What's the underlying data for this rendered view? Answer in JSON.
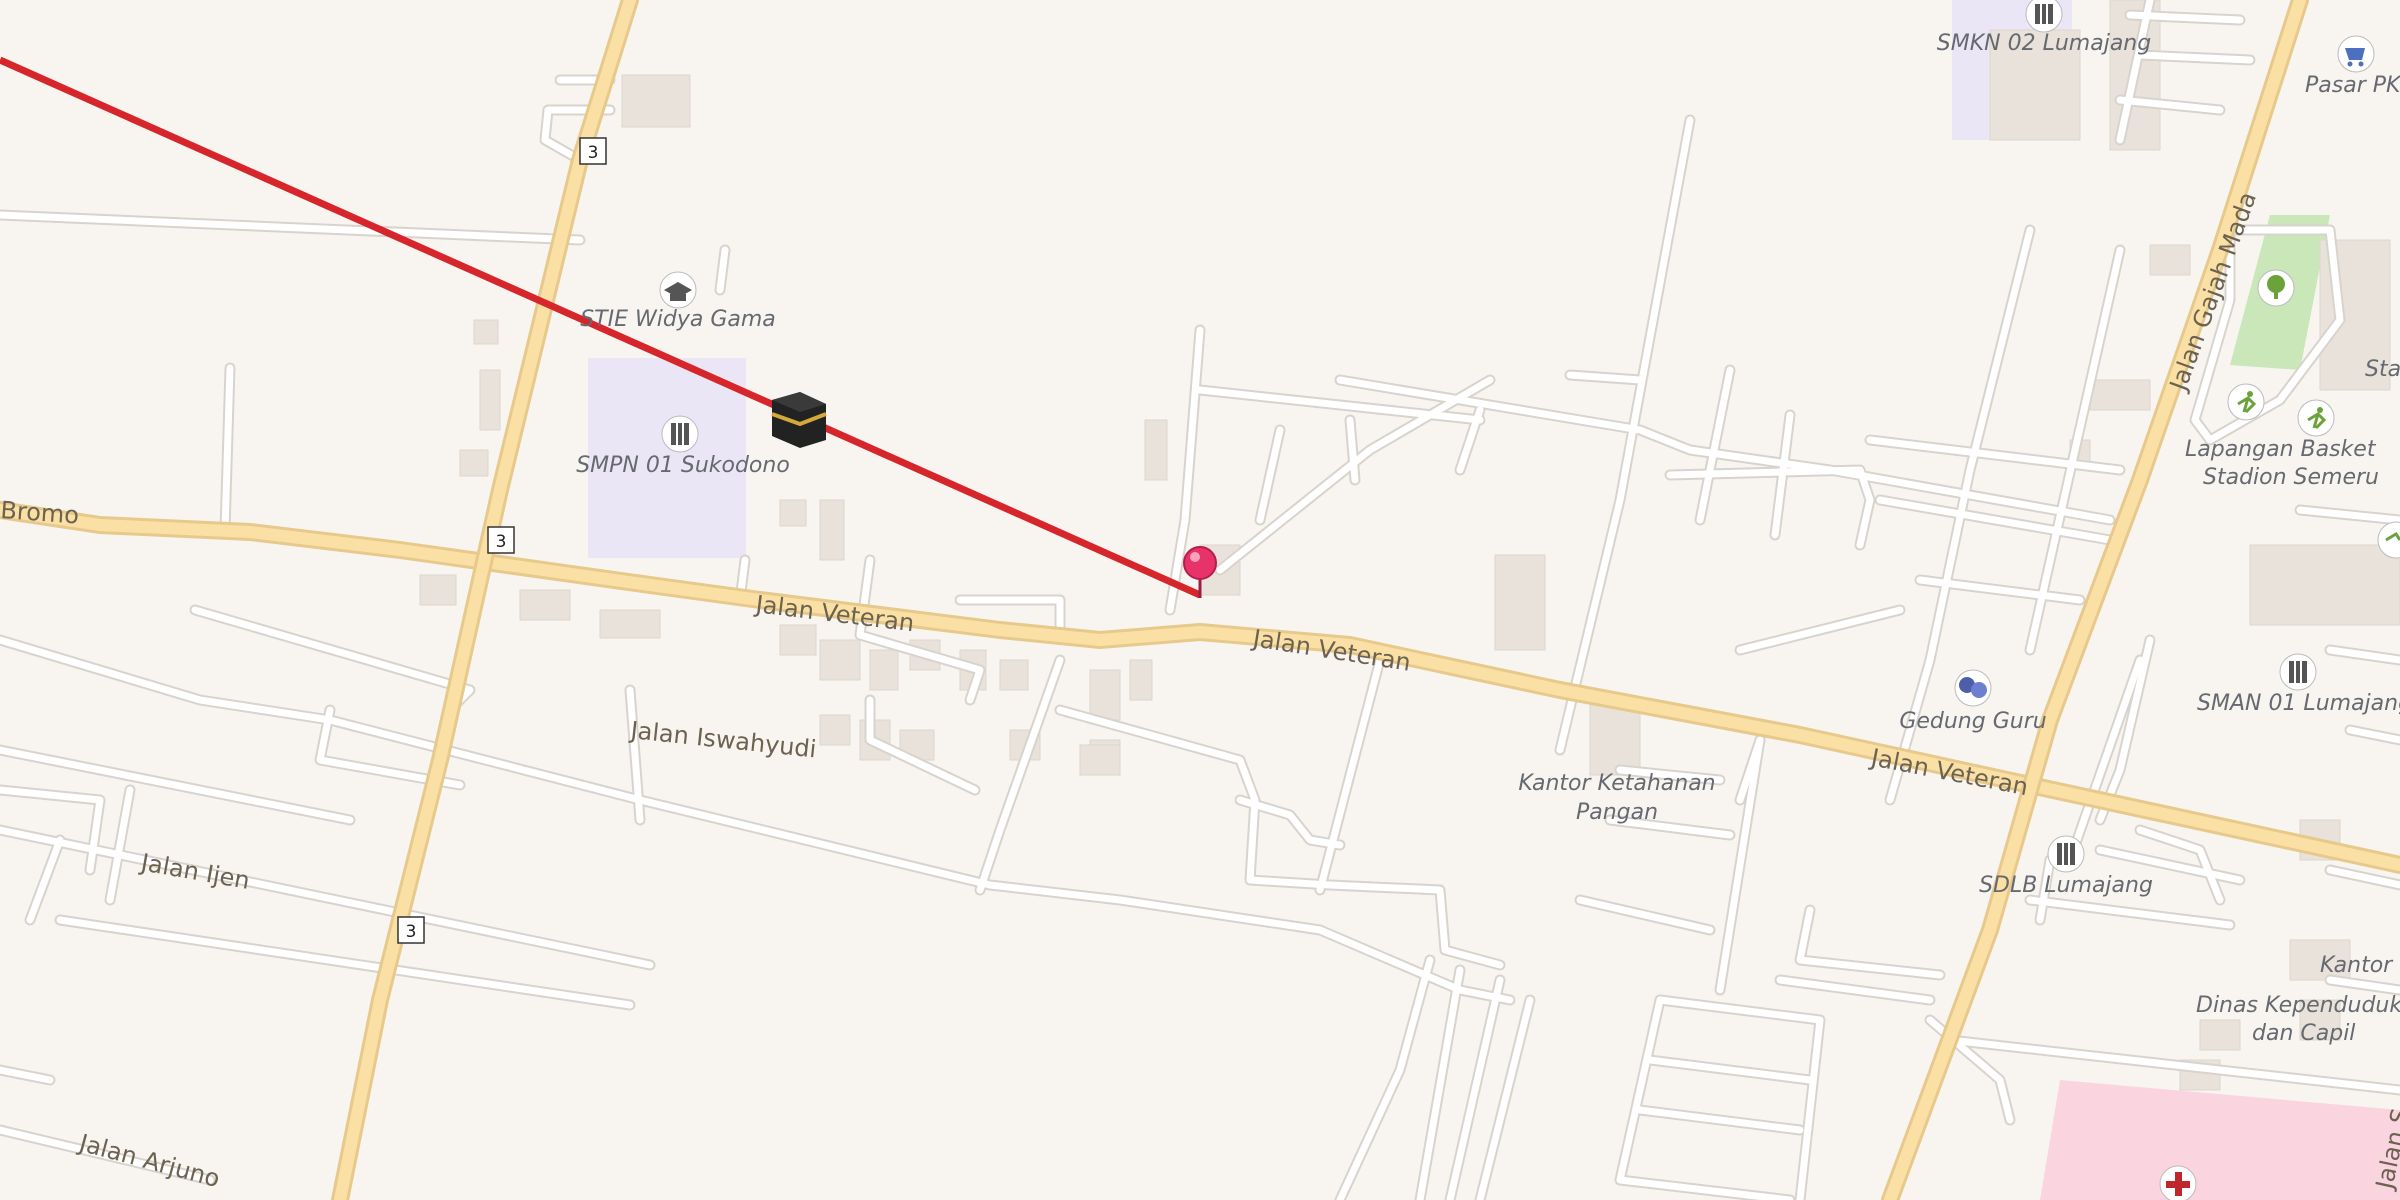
{
  "map": {
    "route_color": "#d6262b",
    "pin_color": "#e8336a",
    "road_labels": {
      "veteran": "Jalan Veteran",
      "iswahyudi": "Jalan Iswahyudi",
      "ijen": "Jalan Ijen",
      "arjuno": "Jalan Arjuno",
      "gajah_mada": "Jalan Gajah Mada",
      "bromo": "Bromo",
      "sudirman_partial": "Jalan S"
    },
    "route_shield": "3",
    "places": {
      "stie": "STIE Widya Gama",
      "smpn": "SMPN 01 Sukodono",
      "smkn": "SMKN 02 Lumajang",
      "pasar": "Pasar PK",
      "gedung_guru": "Gedung Guru",
      "kantor_pangan_1": "Kantor Ketahanan",
      "kantor_pangan_2": "Pangan",
      "sman": "SMAN 01 Lumajang",
      "sdlb": "SDLB Lumajang",
      "lapangan_1": "Lapangan Basket",
      "lapangan_2": "Stadion Semeru",
      "stad": "Stad",
      "kantor": "Kantor",
      "dinas_1": "Dinas Kependudukan",
      "dinas_2": "dan Capil"
    },
    "icons": [
      "school-icon",
      "graduation-cap-icon",
      "shopping-cart-icon",
      "theatre-icon",
      "tree-icon",
      "sports-icon",
      "hospital-icon",
      "kaaba-icon",
      "map-pin-icon"
    ]
  }
}
